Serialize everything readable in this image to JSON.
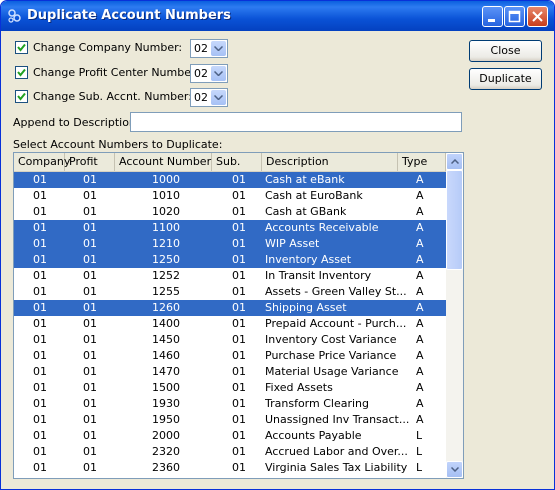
{
  "window": {
    "title": "Duplicate Account Numbers"
  },
  "options": {
    "change_company": {
      "label": "Change Company Number:",
      "value": "02",
      "checked": true
    },
    "change_profit": {
      "label": "Change Profit Center Number:",
      "value": "02",
      "checked": true
    },
    "change_sub": {
      "label": "Change Sub. Accnt. Number:",
      "value": "02",
      "checked": true
    }
  },
  "append": {
    "label": "Append to Description:",
    "value": ""
  },
  "buttons": {
    "close": "Close",
    "duplicate": "Duplicate"
  },
  "list": {
    "label": "Select Account Numbers to Duplicate:",
    "columns": [
      "Company",
      "Profit",
      "Account Number",
      "Sub.",
      "Description",
      "Type"
    ],
    "rows": [
      {
        "company": "01",
        "profit": "01",
        "account": "1000",
        "sub": "01",
        "description": "Cash at eBank",
        "type": "A",
        "selected": true
      },
      {
        "company": "01",
        "profit": "01",
        "account": "1010",
        "sub": "01",
        "description": "Cash at EuroBank",
        "type": "A",
        "selected": false
      },
      {
        "company": "01",
        "profit": "01",
        "account": "1020",
        "sub": "01",
        "description": "Cash at GBank",
        "type": "A",
        "selected": false
      },
      {
        "company": "01",
        "profit": "01",
        "account": "1100",
        "sub": "01",
        "description": "Accounts Receivable",
        "type": "A",
        "selected": true
      },
      {
        "company": "01",
        "profit": "01",
        "account": "1210",
        "sub": "01",
        "description": "WIP Asset",
        "type": "A",
        "selected": true
      },
      {
        "company": "01",
        "profit": "01",
        "account": "1250",
        "sub": "01",
        "description": "Inventory Asset",
        "type": "A",
        "selected": true
      },
      {
        "company": "01",
        "profit": "01",
        "account": "1252",
        "sub": "01",
        "description": "In Transit Inventory",
        "type": "A",
        "selected": false
      },
      {
        "company": "01",
        "profit": "01",
        "account": "1255",
        "sub": "01",
        "description": "Assets - Green Valley St...",
        "type": "A",
        "selected": false
      },
      {
        "company": "01",
        "profit": "01",
        "account": "1260",
        "sub": "01",
        "description": "Shipping Asset",
        "type": "A",
        "selected": true
      },
      {
        "company": "01",
        "profit": "01",
        "account": "1400",
        "sub": "01",
        "description": "Prepaid Account - Purch...",
        "type": "A",
        "selected": false
      },
      {
        "company": "01",
        "profit": "01",
        "account": "1450",
        "sub": "01",
        "description": "Inventory Cost Variance",
        "type": "A",
        "selected": false
      },
      {
        "company": "01",
        "profit": "01",
        "account": "1460",
        "sub": "01",
        "description": "Purchase Price Variance",
        "type": "A",
        "selected": false
      },
      {
        "company": "01",
        "profit": "01",
        "account": "1470",
        "sub": "01",
        "description": "Material Usage Variance",
        "type": "A",
        "selected": false
      },
      {
        "company": "01",
        "profit": "01",
        "account": "1500",
        "sub": "01",
        "description": "Fixed Assets",
        "type": "A",
        "selected": false
      },
      {
        "company": "01",
        "profit": "01",
        "account": "1930",
        "sub": "01",
        "description": "Transform Clearing",
        "type": "A",
        "selected": false
      },
      {
        "company": "01",
        "profit": "01",
        "account": "1950",
        "sub": "01",
        "description": "Unassigned Inv Transact...",
        "type": "A",
        "selected": false
      },
      {
        "company": "01",
        "profit": "01",
        "account": "2000",
        "sub": "01",
        "description": "Accounts Payable",
        "type": "L",
        "selected": false
      },
      {
        "company": "01",
        "profit": "01",
        "account": "2320",
        "sub": "01",
        "description": "Accrued Labor and Over...",
        "type": "L",
        "selected": false
      },
      {
        "company": "01",
        "profit": "01",
        "account": "2360",
        "sub": "01",
        "description": "Virginia Sales Tax Liability",
        "type": "L",
        "selected": false
      }
    ]
  },
  "colors": {
    "title_bar": "#0a52d6",
    "selection": "#316ac5",
    "face": "#ece9d8"
  },
  "icons": [
    "app-icon",
    "minimize-icon",
    "maximize-icon",
    "close-icon",
    "checkmark-icon",
    "dropdown-arrow-icon",
    "scroll-up-icon",
    "scroll-down-icon"
  ]
}
